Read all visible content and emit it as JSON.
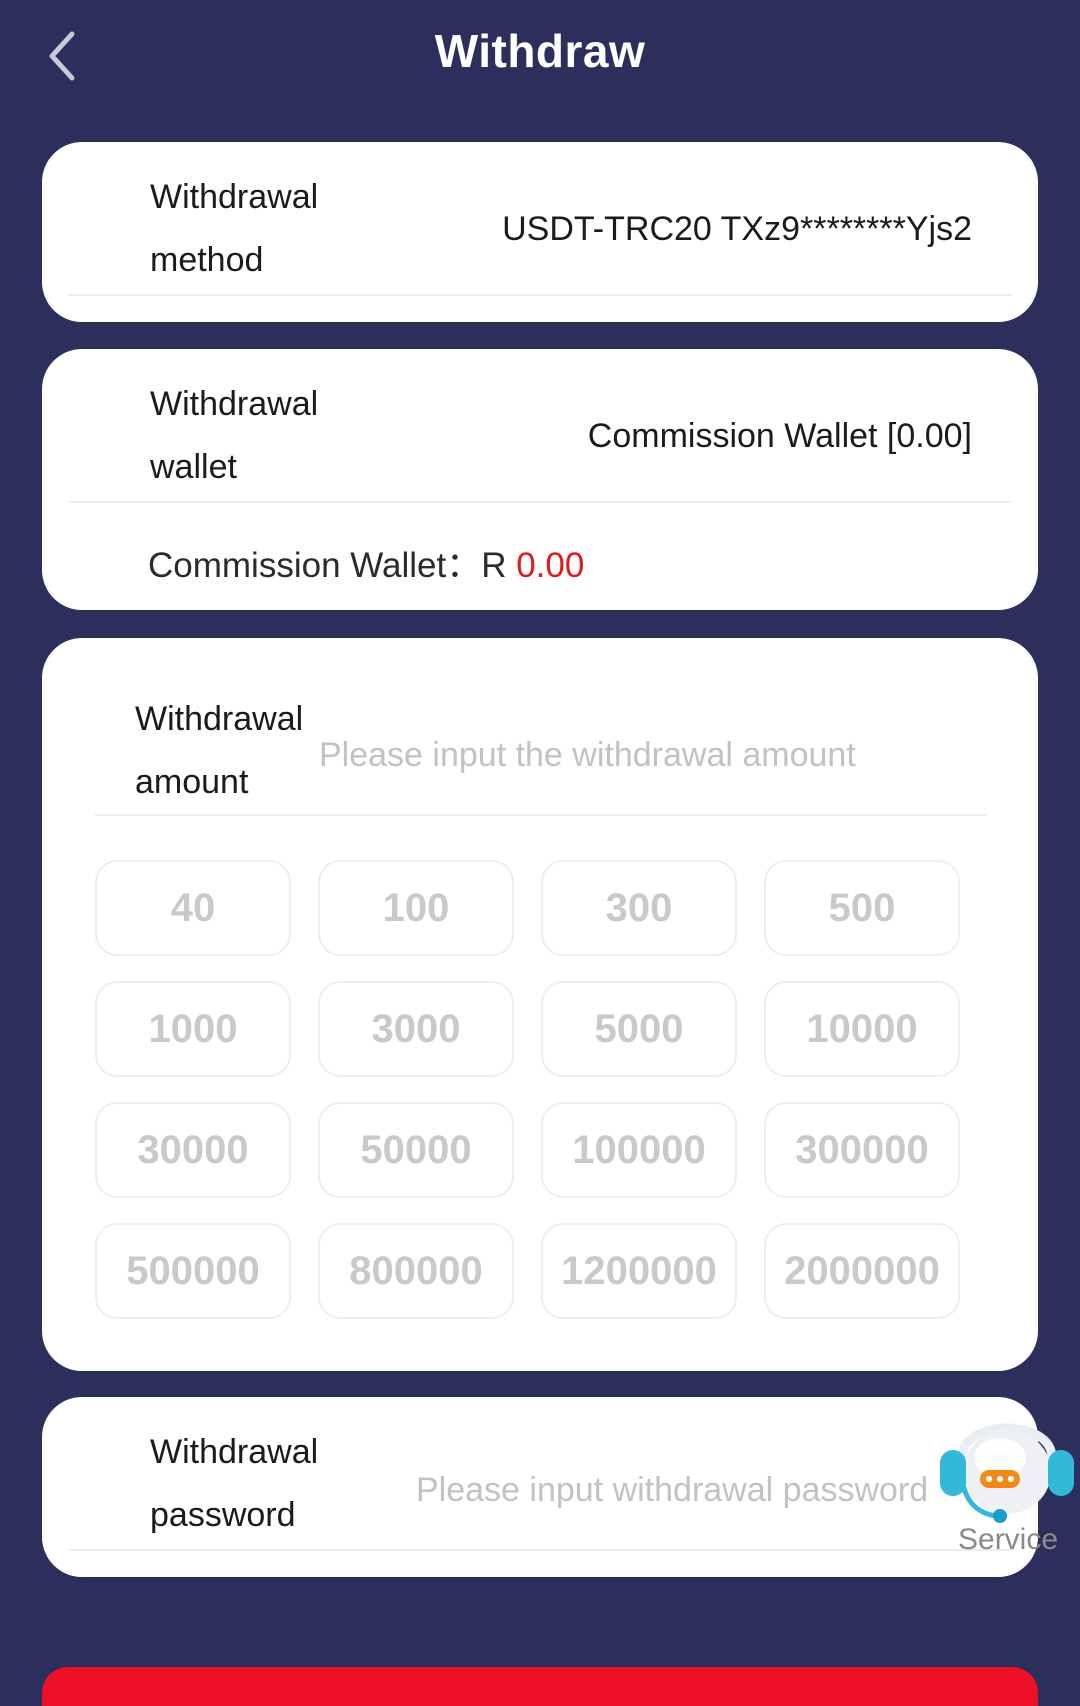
{
  "header": {
    "title": "Withdraw",
    "back_icon": "chevron-left-icon"
  },
  "method": {
    "label": "Withdrawal method",
    "value": "USDT-TRC20 TXz9********Yjs2"
  },
  "wallet": {
    "label": "Withdrawal wallet",
    "value": "Commission Wallet [0.00]",
    "balance_label": "Commission Wallet：R ",
    "balance_amount": "0.00",
    "balance_color": "#e01b1b"
  },
  "amount": {
    "label": "Withdrawal amount",
    "placeholder": "Please input the withdrawal amount",
    "presets": [
      "40",
      "100",
      "300",
      "500",
      "1000",
      "3000",
      "5000",
      "10000",
      "30000",
      "50000",
      "100000",
      "300000",
      "500000",
      "800000",
      "1200000",
      "2000000"
    ]
  },
  "password": {
    "label": "Withdrawal password",
    "placeholder": "Please input withdrawal password"
  },
  "service": {
    "label": "Service",
    "icon": "headset-chat-icon"
  },
  "colors": {
    "background": "#2c2f5c",
    "accent": "#ee1027"
  }
}
